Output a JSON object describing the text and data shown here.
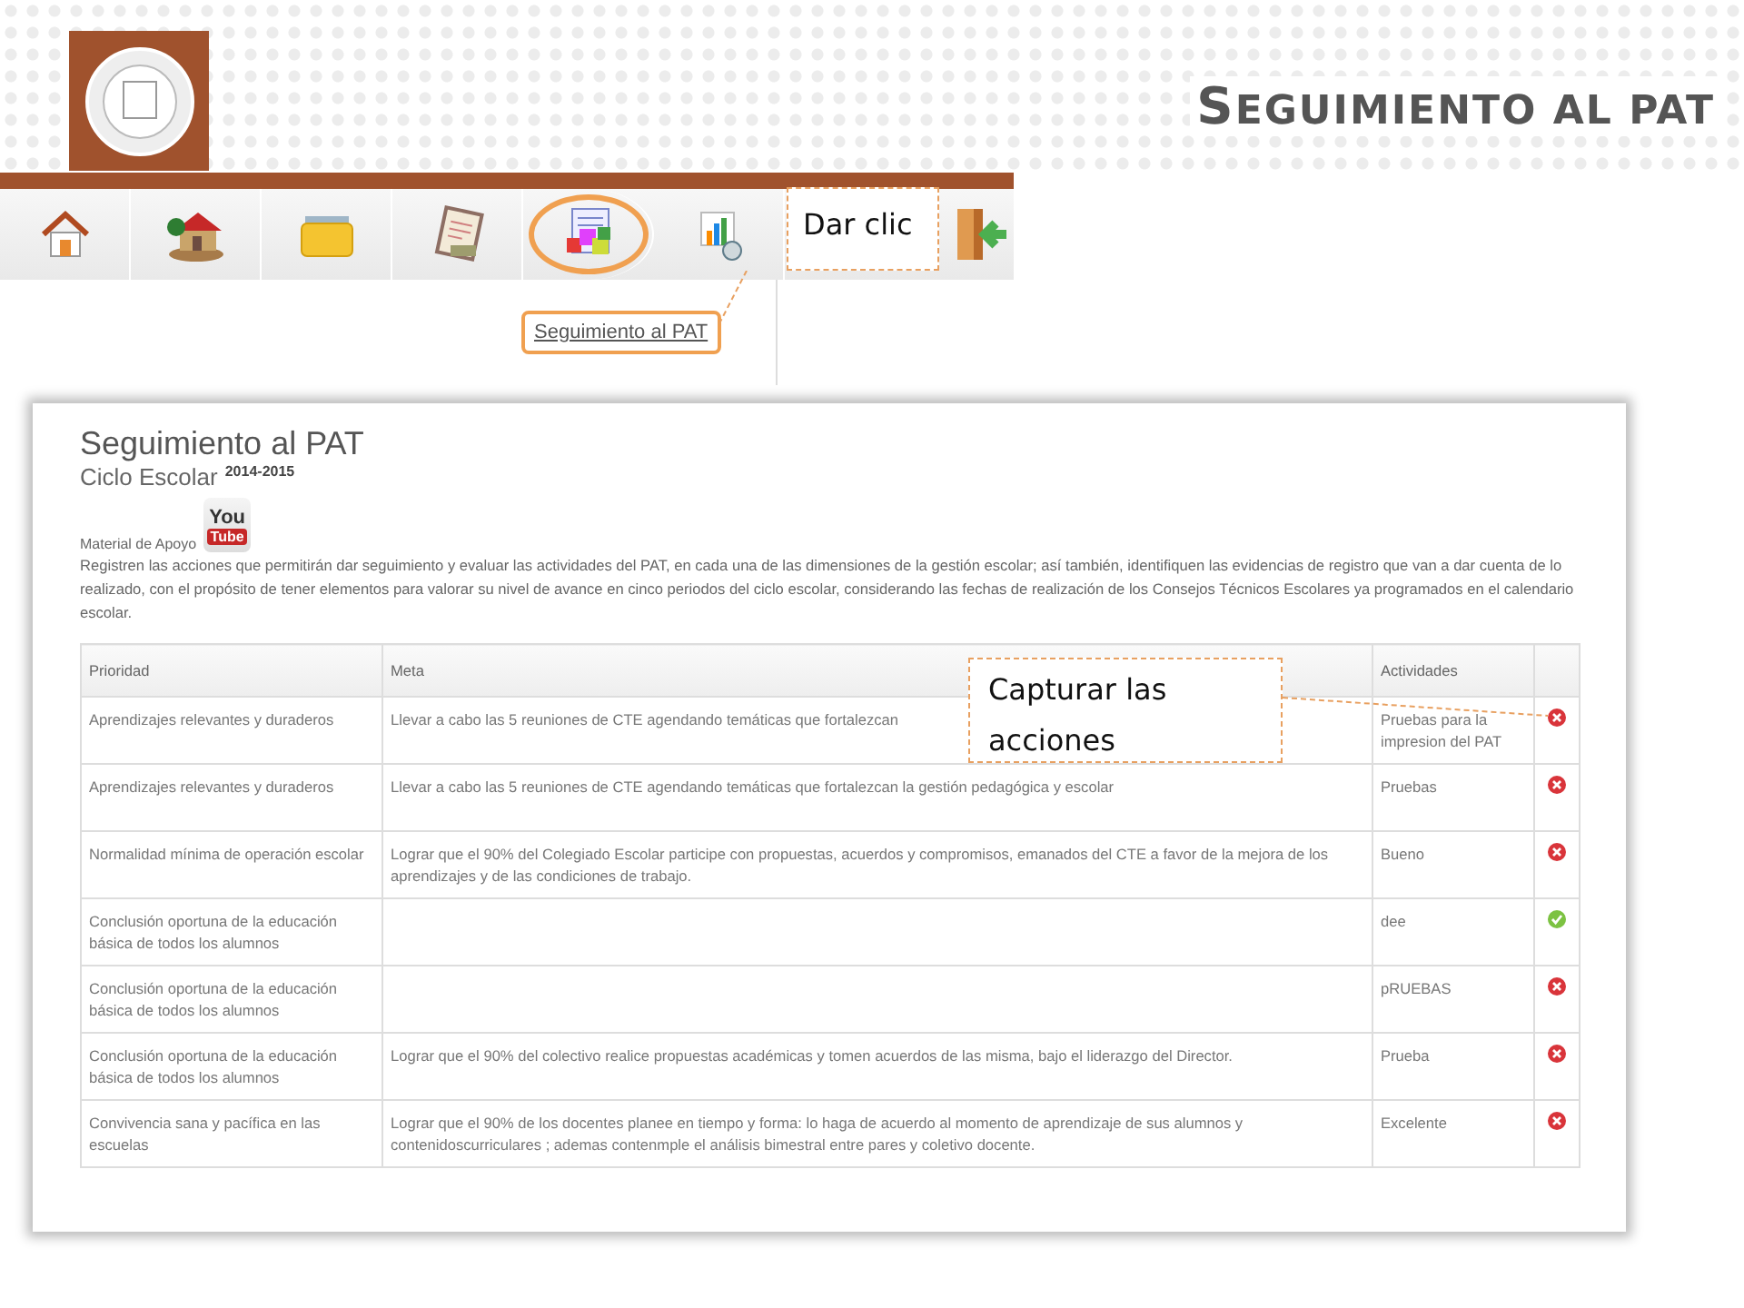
{
  "slide_title": "SEGUIMIENTO AL PAT",
  "toolbar": {
    "items": [
      {
        "selected": false
      },
      {
        "selected": false
      },
      {
        "selected": false
      },
      {
        "selected": false
      },
      {
        "selected": true
      },
      {
        "selected": false
      },
      {
        "selected": false
      }
    ]
  },
  "menu": {
    "item": "Seguimiento al PAT"
  },
  "callouts": [
    {
      "text": "Dar clic"
    },
    {
      "text": "Capturar las acciones"
    }
  ],
  "panel": {
    "title": "Seguimiento al PAT",
    "subtitle": "Ciclo Escolar",
    "year": "2014-2015",
    "support_label": "Material de Apoyo",
    "video_logo": {
      "top": "You",
      "bottom": "Tube"
    },
    "description": "Registren las acciones que permitirán dar seguimiento y evaluar las actividades del PAT, en cada una de las dimensiones de la gestión escolar; así también, identifiquen las evidencias de registro que van a dar cuenta de lo realizado, con el propósito de tener elementos para valorar su nivel de avance en cinco periodos del ciclo escolar, considerando las fechas de realización de los Consejos Técnicos Escolares ya programados en el calendario escolar.",
    "table": {
      "columns": [
        "Prioridad",
        "Meta",
        "Actividades"
      ],
      "rows": [
        {
          "prioridad": "Aprendizajes relevantes y duraderos",
          "meta": "Llevar a cabo las 5 reuniones de CTE agendando temáticas que fortalezcan",
          "actividades": "Pruebas para la impresion del PAT",
          "complete": false
        },
        {
          "prioridad": "Aprendizajes relevantes y duraderos",
          "meta": "Llevar a cabo las 5 reuniones de CTE agendando temáticas que fortalezcan la gestión pedagógica y escolar",
          "actividades": "Pruebas",
          "complete": false
        },
        {
          "prioridad": "Normalidad mínima de operación escolar",
          "meta": "Lograr que el 90% del Colegiado Escolar participe con propuestas, acuerdos y compromisos, emanados del CTE a favor de la mejora de los aprendizajes y de las condiciones de trabajo.",
          "actividades": "Bueno",
          "complete": false
        },
        {
          "prioridad": "Conclusión oportuna de la educación básica de todos los alumnos",
          "actividades": "dee",
          "complete": true
        },
        {
          "prioridad": "Conclusión oportuna de la educación básica de todos los alumnos",
          "actividades": "pRUEBAS",
          "complete": false
        },
        {
          "prioridad": "Conclusión oportuna de la educación básica de todos los alumnos",
          "meta": "Lograr que el 90% del colectivo realice propuestas académicas y tomen acuerdos de las misma, bajo el liderazgo del Director.",
          "actividades": "Prueba",
          "complete": false
        },
        {
          "prioridad": "Convivencia sana y pacífica en las escuelas",
          "meta": "Lograr que el 90% de los docentes planee en tiempo y forma: lo haga de acuerdo al momento de aprendizaje de sus alumnos y contenidoscurriculares ; ademas contenmple el análisis bimestral entre pares y coletivo docente.",
          "actividades": "Excelente",
          "complete": false
        }
      ]
    }
  }
}
